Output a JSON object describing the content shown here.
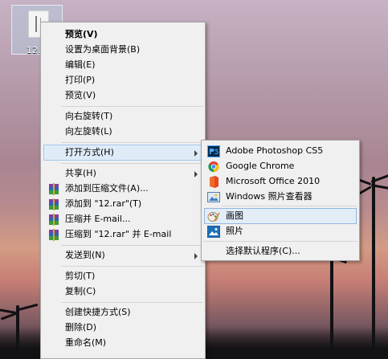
{
  "desktop": {
    "icon_label": "12.r"
  },
  "context_menu": {
    "items": [
      "预览(V)",
      "设置为桌面背景(B)",
      "编辑(E)",
      "打印(P)",
      "预览(V)",
      "向右旋转(T)",
      "向左旋转(L)",
      "打开方式(H)",
      "共享(H)",
      "添加到压缩文件(A)...",
      "添加到 \"12.rar\"(T)",
      "压缩并 E-mail...",
      "压缩到 \"12.rar\" 并 E-mail",
      "发送到(N)",
      "剪切(T)",
      "复制(C)",
      "创建快捷方式(S)",
      "删除(D)",
      "重命名(M)"
    ]
  },
  "open_with_menu": {
    "items": [
      "Adobe Photoshop CS5",
      "Google Chrome",
      "Microsoft Office 2010",
      "Windows 照片查看器",
      "画图",
      "照片",
      "选择默认程序(C)..."
    ]
  },
  "icons": {
    "photoshop": "photoshop-icon",
    "chrome": "chrome-icon",
    "office": "office-icon",
    "viewer": "photo-viewer-icon",
    "paint": "paint-icon",
    "photos": "photos-icon",
    "winrar": "winrar-icon"
  },
  "colors": {
    "menu_bg": "#f0f0f0",
    "hover_bg": "#dfecf8",
    "hover_border": "#a4c8ea"
  }
}
